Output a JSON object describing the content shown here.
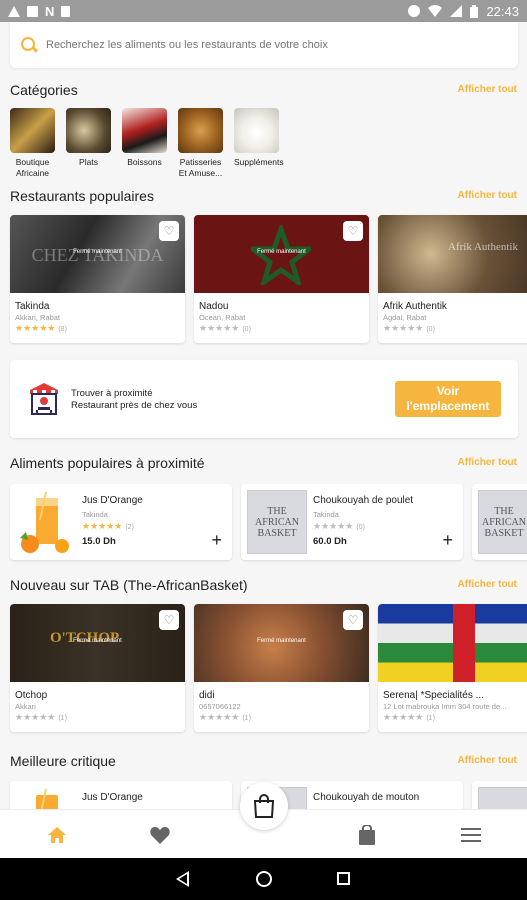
{
  "status_bar": {
    "time": "22:43",
    "left_icons": [
      "warning-icon",
      "image-icon",
      "n-icon",
      "sd-card-icon"
    ],
    "right_icons": [
      "dnd-icon",
      "wifi-icon",
      "signal-icon",
      "battery-icon"
    ]
  },
  "search": {
    "placeholder": "Recherchez les aliments ou les restaurants de votre choix"
  },
  "colors": {
    "accent": "#f6b53f",
    "background": "#f6f6f6"
  },
  "categories": {
    "title": "Catégories",
    "see_all": "Afficher tout",
    "items": [
      {
        "label": "Boutique Africaine"
      },
      {
        "label": "Plats"
      },
      {
        "label": "Boissons"
      },
      {
        "label": "Patisseries Et Amuse..."
      },
      {
        "label": "Suppléments"
      }
    ]
  },
  "popular_restaurants": {
    "title": "Restaurants populaires",
    "see_all": "Afficher tout",
    "items": [
      {
        "name": "Takinda",
        "location": "Akkari, Rabat",
        "rating": 5,
        "reviews": "(8)",
        "status": "Fermé maintenant",
        "image_text": "CHEZ TAKINDA"
      },
      {
        "name": "Nadou",
        "location": "Ocean, Rabat",
        "rating": 0,
        "reviews": "(0)",
        "status": "Fermé maintenant",
        "image_text": ""
      },
      {
        "name": "Afrik Authentik",
        "location": "Agdal, Rabat",
        "rating": 0,
        "reviews": "(0)",
        "status": "",
        "image_text": "Afrik Authentik"
      }
    ]
  },
  "nearby": {
    "line1": "Trouver à proximité",
    "line2": "Restaurant près de chez vous",
    "button": "Voir l'emplacement"
  },
  "popular_foods": {
    "title": "Aliments populaires à proximité",
    "see_all": "Afficher tout",
    "items": [
      {
        "name": "Jus D'Orange",
        "restaurant": "Takinda",
        "rating": 5,
        "reviews": "(2)",
        "price": "15.0 Dh"
      },
      {
        "name": "Choukouyah de poulet",
        "restaurant": "Takinda",
        "rating": 0,
        "reviews": "(0)",
        "price": "60.0 Dh"
      }
    ]
  },
  "new_on_tab": {
    "title": "Nouveau sur TAB (The-AfricanBasket)",
    "see_all": "Afficher tout",
    "items": [
      {
        "name": "Otchop",
        "location": "Akkari",
        "rating": 0,
        "reviews": "(1)",
        "status": "Fermé maintenant",
        "image_text": "O'TCHOP"
      },
      {
        "name": "didi",
        "location": "0657066122",
        "rating": 0,
        "reviews": "(1)",
        "status": "Fermé maintenant"
      },
      {
        "name": "Serena| *Specialités ...",
        "location": "12 Lot mabrouka Imm 304 route de...",
        "rating": 0,
        "reviews": "(1)",
        "status": ""
      }
    ]
  },
  "best_reviews": {
    "title": "Meilleure critique",
    "see_all": "Afficher tout",
    "items": [
      {
        "name": "Jus D'Orange"
      },
      {
        "name": "Choukouyah de mouton"
      }
    ]
  },
  "afb_logo_text": "THE AFRICAN BASKET",
  "bottom_nav": {
    "items": [
      "home-icon",
      "favorites-icon",
      "cart-icon",
      "orders-icon",
      "menu-icon"
    ]
  }
}
